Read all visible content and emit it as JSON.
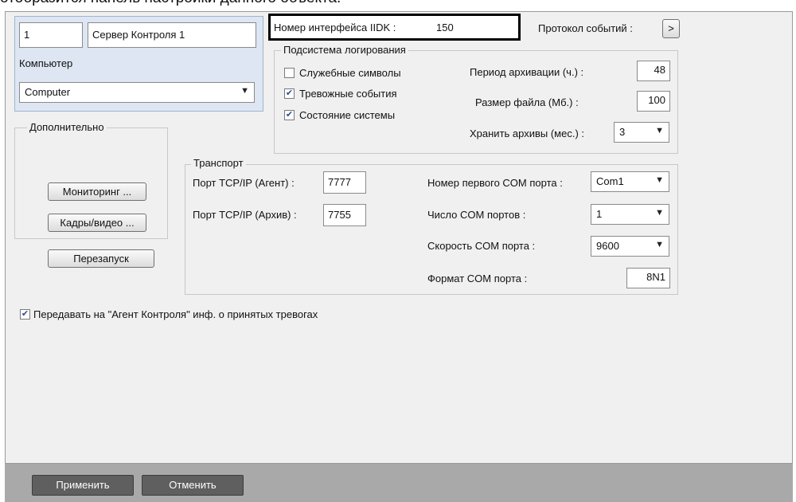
{
  "caption": "отобразится панель настройки данного объекта.",
  "object": {
    "id": "1",
    "name": "Сервер Контроля 1"
  },
  "computer": {
    "label": "Компьютер",
    "value": "Computer"
  },
  "iidk": {
    "label": "Номер интерфейса IIDK :",
    "value": "150"
  },
  "event_log": {
    "label": "Протокол событий :",
    "button": ">"
  },
  "logging": {
    "title": "Подсистема логирования",
    "checkboxes": [
      {
        "label": "Служебные символы",
        "checked": false
      },
      {
        "label": "Тревожные события",
        "checked": true
      },
      {
        "label": "Состояние системы",
        "checked": true
      }
    ],
    "archive_period": {
      "label": "Период архивации (ч.) :",
      "value": "48"
    },
    "file_size": {
      "label": "Размер файла (Мб.) :",
      "value": "100"
    },
    "keep_archives": {
      "label": "Хранить архивы (мес.) :",
      "value": "3"
    }
  },
  "additional": {
    "title": "Дополнительно",
    "monitoring_button": "Мониторинг ...",
    "frames_button": "Кадры/видео ...",
    "restart_button": "Перезапуск"
  },
  "transport": {
    "title": "Транспорт",
    "port_agent": {
      "label": "Порт TCP/IP (Агент) :",
      "value": "7777"
    },
    "port_archive": {
      "label": "Порт TCP/IP (Архив) :",
      "value": "7755"
    },
    "first_com": {
      "label": "Номер первого COM порта :",
      "value": "Com1"
    },
    "com_count": {
      "label": "Число COM портов :",
      "value": "1"
    },
    "com_speed": {
      "label": "Скорость COM порта :",
      "value": "9600"
    },
    "com_format": {
      "label": "Формат COM порта :",
      "value": "8N1"
    }
  },
  "send_alarms": {
    "label": "Передавать на \"Агент Контроля\" инф. о принятых тревогах",
    "checked": true
  },
  "footer": {
    "apply": "Применить",
    "cancel": "Отменить"
  },
  "icons": {
    "checkbox_checked": "check-icon",
    "dropdown": "chevron-down-icon"
  }
}
